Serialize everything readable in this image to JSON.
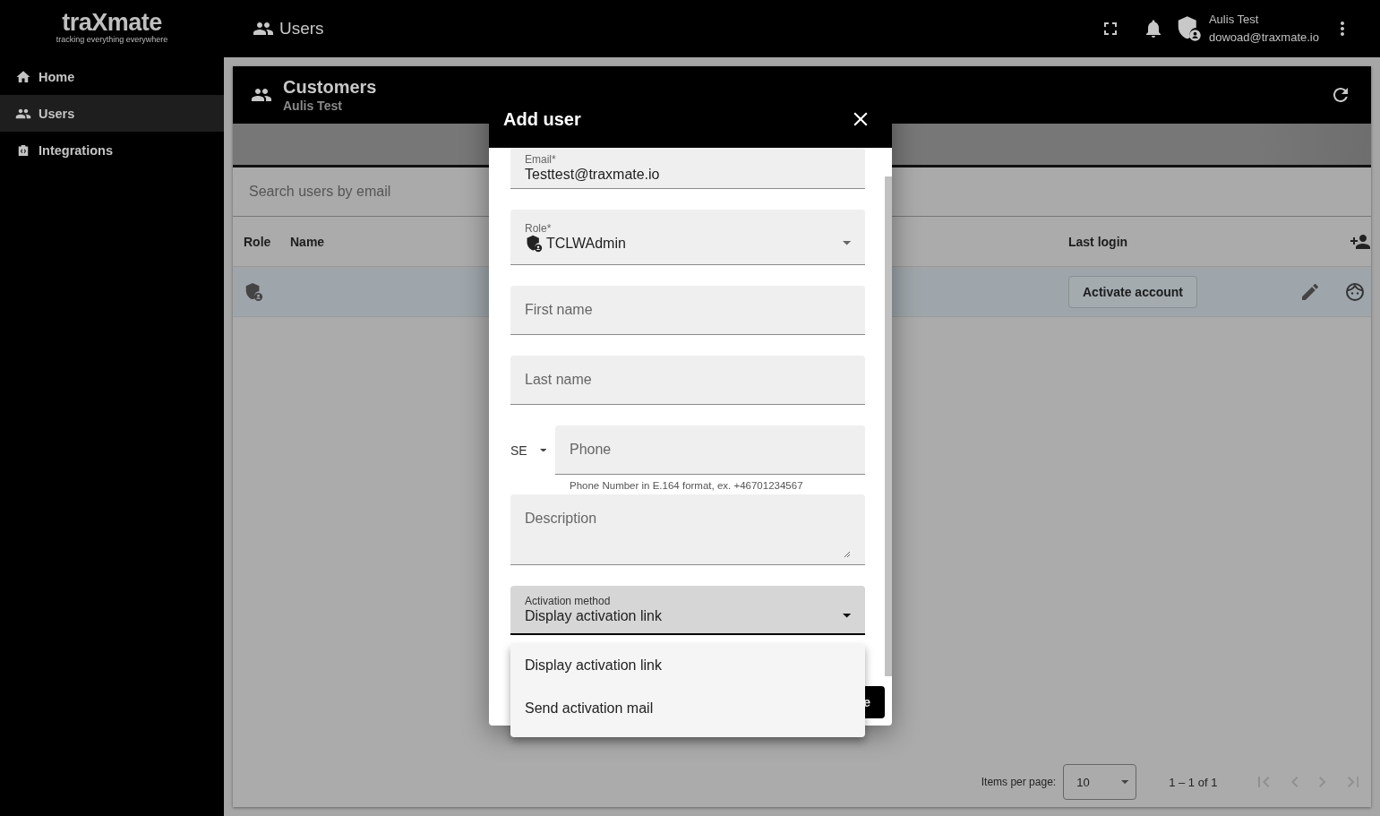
{
  "app": {
    "logo": "traXmate",
    "tagline": "tracking everything everywhere"
  },
  "topbar": {
    "title": "Users",
    "user_name": "Aulis Test",
    "user_email": "dowoad@traxmate.io"
  },
  "sidebar": {
    "items": [
      {
        "label": "Home",
        "kind": "home",
        "selected": false
      },
      {
        "label": "Users",
        "kind": "users",
        "selected": true
      },
      {
        "label": "Integrations",
        "kind": "integrations",
        "selected": false
      }
    ]
  },
  "card": {
    "title": "Customers",
    "subtitle": "Aulis Test",
    "search": {
      "placeholder": "Search users by email"
    },
    "columns": [
      "Role",
      "Name",
      "Last login"
    ],
    "rows": [
      {
        "action": "Activate account",
        "selected": true
      }
    ],
    "paginator": {
      "label": "Items per page:",
      "page_size": "10",
      "range": "1 – 1 of 1"
    }
  },
  "dialog": {
    "title": "Add user",
    "fields": [
      {
        "kind": "text",
        "label": "Email*",
        "value": "Testtest@traxmate.io"
      },
      {
        "kind": "role",
        "label": "Role*",
        "value": "TCLWAdmin"
      },
      {
        "kind": "text",
        "placeholder": "First name"
      },
      {
        "kind": "text",
        "placeholder": "Last name"
      },
      {
        "kind": "phone",
        "country": "SE",
        "placeholder": "Phone",
        "hint": "Phone Number in E.164 format, ex. +46701234567"
      },
      {
        "kind": "textarea",
        "placeholder": "Description"
      },
      {
        "kind": "select",
        "label": "Activation method",
        "value": "Display activation link",
        "focused": true
      }
    ],
    "button": "e"
  },
  "dropdown": {
    "options": [
      {
        "label": "Display activation link"
      },
      {
        "label": "Send activation mail"
      }
    ]
  }
}
